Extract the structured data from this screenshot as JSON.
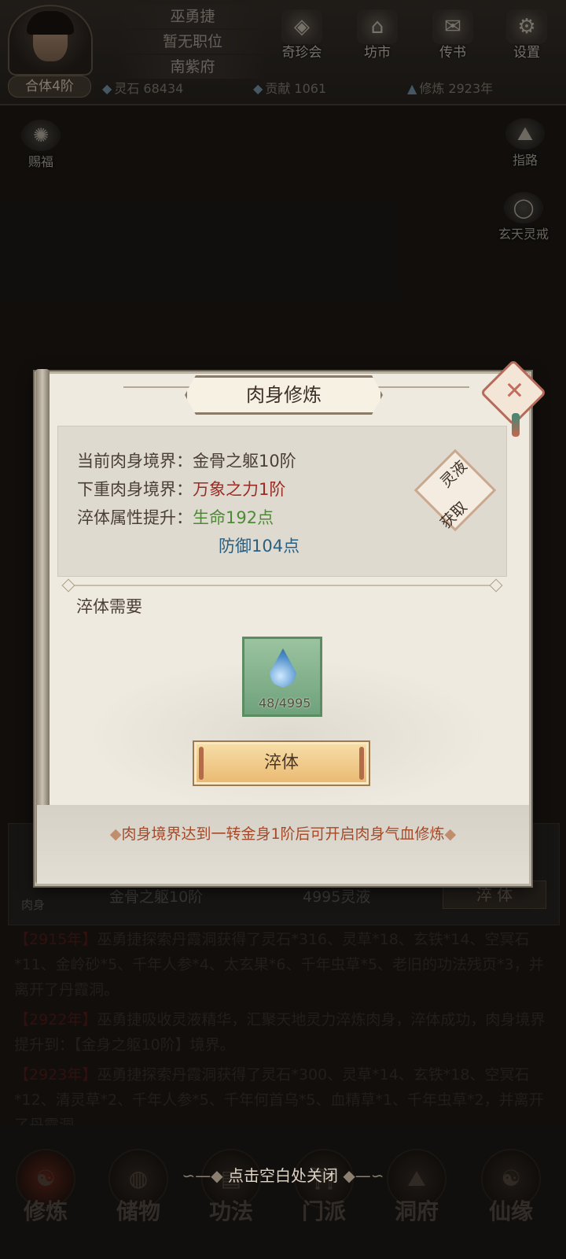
{
  "header": {
    "player_name": "巫勇捷",
    "position": "暂无职位",
    "location": "南紫府",
    "realm": "合体4阶",
    "menu": [
      {
        "label": "奇珍会",
        "icon": "treasure-icon"
      },
      {
        "label": "坊市",
        "icon": "market-icon"
      },
      {
        "label": "传书",
        "icon": "letter-icon"
      },
      {
        "label": "设置",
        "icon": "gear-icon"
      }
    ],
    "resources": {
      "spirit_stone_label": "灵石",
      "spirit_stone_value": "68434",
      "contribution_label": "贡献",
      "contribution_value": "1061",
      "cultivation_label": "修炼",
      "cultivation_value": "2923年"
    }
  },
  "side": {
    "left_top": "赐福",
    "right_top": "指路",
    "right_second": "玄天灵戒"
  },
  "background_panel": {
    "icon_label": "肉身",
    "realm": "金骨之躯10阶",
    "cost": "4995灵液",
    "button": "淬 体"
  },
  "log": [
    {
      "year": "【2915年】",
      "text": "巫勇捷探索丹霞洞获得了灵石*316、灵草*18、玄铁*14、空冥石*11、金岭砂*5、千年人参*4、太玄果*6、千年虫草*5、老旧的功法残页*3，并离开了丹霞洞。"
    },
    {
      "year": "【2922年】",
      "text": "巫勇捷吸收灵液精华，汇聚天地灵力淬炼肉身，淬体成功，肉身境界提升到：【金身之躯10阶】境界。"
    },
    {
      "year": "【2923年】",
      "text": "巫勇捷探索丹霞洞获得了灵石*300、灵草*14、玄铁*18、空冥石*12、清灵草*2、千年人参*5、千年何首乌*5、血精草*1、千年虫草*2，并离开了丹霞洞。"
    }
  ],
  "bottom_nav": [
    {
      "label": "修炼",
      "icon": "meditation-icon"
    },
    {
      "label": "储物",
      "icon": "bag-icon"
    },
    {
      "label": "功法",
      "icon": "scroll-icon"
    },
    {
      "label": "门派",
      "icon": "gate-icon"
    },
    {
      "label": "洞府",
      "icon": "cave-icon"
    },
    {
      "label": "仙缘",
      "icon": "yin-yang-icon"
    }
  ],
  "close_hint": "点击空白处关闭",
  "dialog": {
    "title": "肉身修炼",
    "current_label": "当前肉身境界：",
    "current_value": "金骨之躯10阶",
    "next_label": "下重肉身境界：",
    "next_value": "万象之力1阶",
    "attr_label": "淬体属性提升：",
    "attr_hp": "生命192点",
    "attr_def": "防御104点",
    "get_button_line1": "灵液",
    "get_button_line2": "获取",
    "need_label": "淬体需要",
    "item_count": "48/4995",
    "temper_button": "淬体",
    "footer_note": "肉身境界达到一转金身1阶后可开启肉身气血修炼"
  }
}
